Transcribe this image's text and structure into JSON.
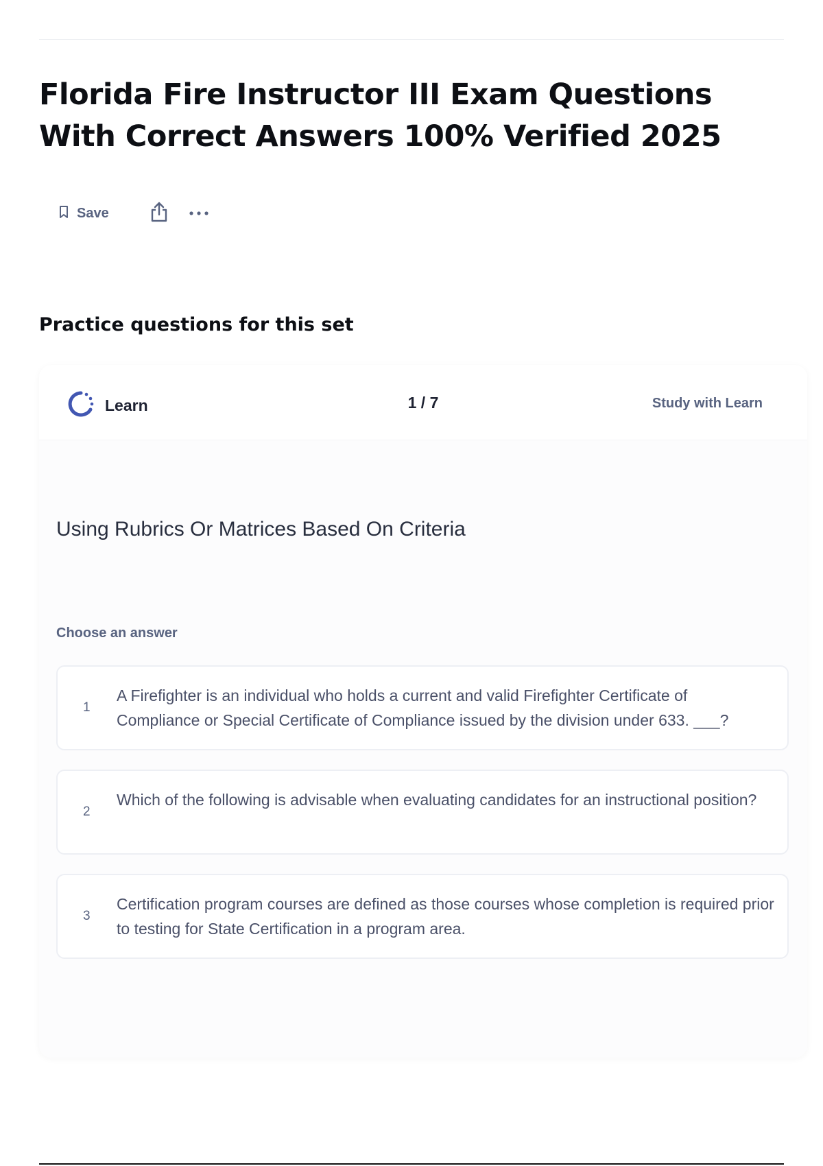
{
  "page": {
    "title": "Florida Fire Instructor III Exam Questions With Correct Answers 100% Verified 2025"
  },
  "toolbar": {
    "save_label": "Save",
    "save_icon": "bookmark-icon",
    "share_icon": "share-icon",
    "more_icon": "more-horizontal-icon"
  },
  "practice": {
    "heading": "Practice questions for this set",
    "mode_label": "Learn",
    "mode_icon": "learn-progress-icon",
    "progress": "1 / 7",
    "study_link": "Study with Learn",
    "term": "Using Rubrics Or Matrices Based On Criteria",
    "choose_label": "Choose an answer",
    "answers": [
      {
        "number": "1",
        "text": "A Firefighter is an individual who holds a current and valid Firefighter Certificate of Compliance or Special Certificate of Compliance issued by the division under 633. ___?"
      },
      {
        "number": "2",
        "text": "Which of the following is advisable when evaluating candidates for an instructional position?"
      },
      {
        "number": "3",
        "text": "Certification program courses are defined as those courses whose completion is required prior to testing for State Certification in a program area."
      }
    ]
  },
  "colors": {
    "accent": "#4257b2",
    "text_primary": "#0d0f14",
    "text_secondary": "#586380",
    "border": "#edeff4"
  }
}
